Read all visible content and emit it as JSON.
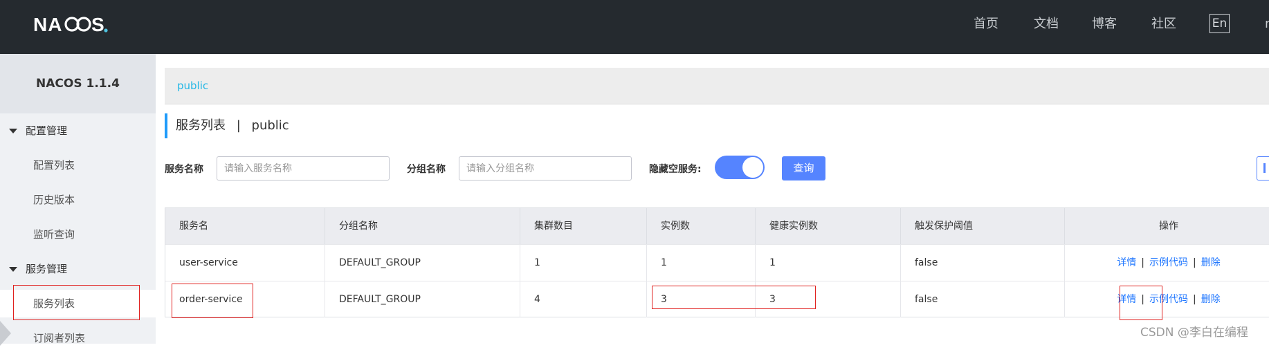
{
  "topbar": {
    "logo_text": "NACOS.",
    "nav": [
      "首页",
      "文档",
      "博客",
      "社区"
    ],
    "lang": "En",
    "nav_cut": "n"
  },
  "sidebar": {
    "version": "NACOS 1.1.4",
    "groups": [
      {
        "label": "配置管理",
        "items": [
          "配置列表",
          "历史版本",
          "监听查询"
        ]
      },
      {
        "label": "服务管理",
        "items": [
          "服务列表",
          "订阅者列表"
        ]
      }
    ]
  },
  "main": {
    "breadcrumb": "public",
    "title": "服务列表",
    "title_sep": "|",
    "namespace": "public",
    "filters": {
      "service_label": "服务名称",
      "service_placeholder": "请输入服务名称",
      "group_label": "分组名称",
      "group_placeholder": "请输入分组名称",
      "hide_empty_label": "隐藏空服务:",
      "hide_empty_on": true,
      "query_button": "查询"
    },
    "table": {
      "columns": [
        "服务名",
        "分组名称",
        "集群数目",
        "实例数",
        "健康实例数",
        "触发保护阈值",
        "操作"
      ],
      "rows": [
        {
          "name": "user-service",
          "group": "DEFAULT_GROUP",
          "clusters": "1",
          "instances": "1",
          "healthy": "1",
          "threshold": "false"
        },
        {
          "name": "order-service",
          "group": "DEFAULT_GROUP",
          "clusters": "4",
          "instances": "3",
          "healthy": "3",
          "threshold": "false"
        }
      ],
      "ops": {
        "detail": "详情",
        "sample": "示例代码",
        "delete": "删除",
        "sep": "|"
      }
    }
  },
  "watermark": "CSDN @李白在编程",
  "colors": {
    "topbar": "#252a2f",
    "primary": "#5584ff",
    "link": "#2077ff",
    "annotation": "#e0201e"
  }
}
